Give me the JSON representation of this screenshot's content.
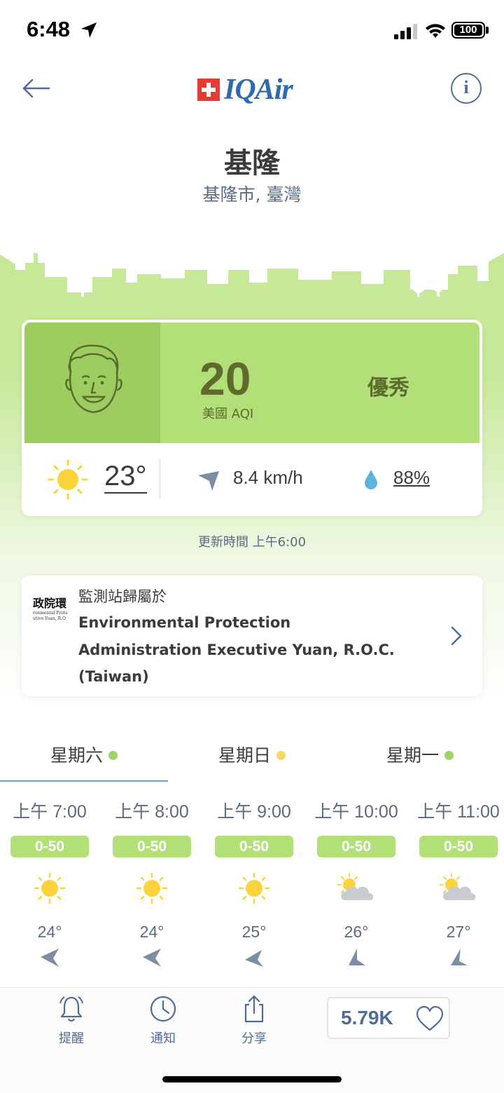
{
  "status_bar": {
    "time": "6:48",
    "battery": "100"
  },
  "header": {
    "logo_text": "IQAir",
    "info_label": "i"
  },
  "location": {
    "city": "基隆",
    "region": "基隆市, 臺灣"
  },
  "aqi": {
    "value": "20",
    "label": "美國 AQI",
    "status": "優秀",
    "color": "#b2df78"
  },
  "weather": {
    "temperature": "23°",
    "wind_speed": "8.4 km/h",
    "humidity": "88%"
  },
  "updated_text": "更新時間 上午6:00",
  "station": {
    "title": "監測站歸屬於",
    "name_line1": "Environmental Protection",
    "name_line2": "Administration Executive Yuan, R.O.C.",
    "name_line3": "(Taiwan)",
    "logo_text": "政院環",
    "logo_subtext_1": "ronmental Prote",
    "logo_subtext_2": "utive Yuan, R.O"
  },
  "day_tabs": [
    {
      "label": "星期六",
      "dot_color": "#9ed36a",
      "active": true
    },
    {
      "label": "星期日",
      "dot_color": "#f5d763",
      "active": false
    },
    {
      "label": "星期一",
      "dot_color": "#9ed36a",
      "active": false
    }
  ],
  "hourly": [
    {
      "time": "上午 7:00",
      "aqi": "0-50",
      "icon": "sun-icon",
      "temp": "24°",
      "wind_icon": "wind-direction-icon"
    },
    {
      "time": "上午 8:00",
      "aqi": "0-50",
      "icon": "sun-icon",
      "temp": "24°",
      "wind_icon": "wind-direction-icon"
    },
    {
      "time": "上午 9:00",
      "aqi": "0-50",
      "icon": "sun-icon",
      "temp": "25°",
      "wind_icon": "wind-direction-icon"
    },
    {
      "time": "上午 10:00",
      "aqi": "0-50",
      "icon": "partly-cloudy-icon",
      "temp": "26°",
      "wind_icon": "wind-direction-icon"
    },
    {
      "time": "上午 11:00",
      "aqi": "0-50",
      "icon": "partly-cloudy-icon",
      "temp": "27°",
      "wind_icon": "wind-direction-icon"
    }
  ],
  "bottom_bar": {
    "alert_label": "提醒",
    "notify_label": "通知",
    "share_label": "分享",
    "likes": "5.79K"
  }
}
